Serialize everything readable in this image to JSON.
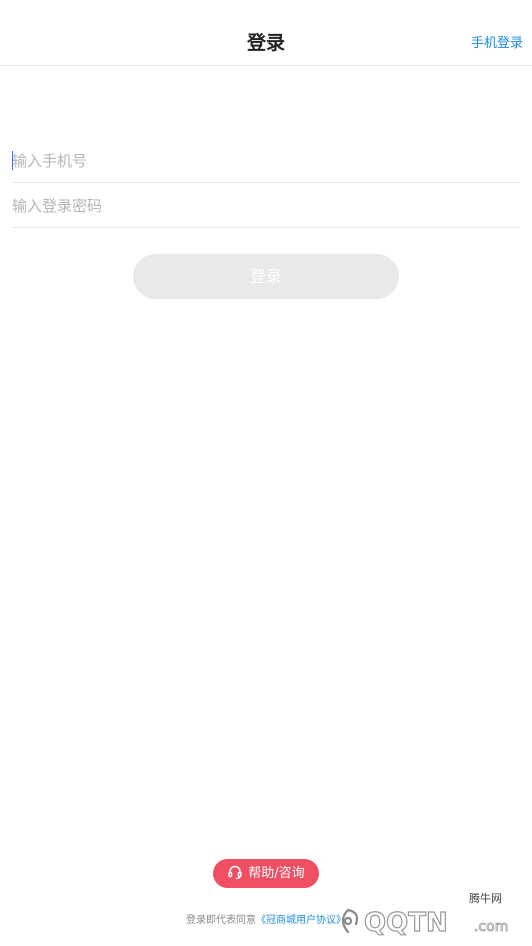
{
  "header": {
    "title": "登录",
    "phone_login_link": "手机登录"
  },
  "form": {
    "phone_placeholder": "输入手机号",
    "password_placeholder": "输入登录密码",
    "login_button": "登录"
  },
  "footer": {
    "help_button": "帮助/咨询",
    "agreement_prefix": "登录即代表同意",
    "agreement_link": "《冠商城用户协议》"
  },
  "watermark": {
    "site_name": "腾牛网",
    "brand_text": "QQTN",
    "domain_suffix": ".com"
  },
  "colors": {
    "accent_blue": "#1f8ce8",
    "help_red": "#f04e63",
    "button_disabled": "#e9e9e9"
  },
  "icons": {
    "help": "headset-icon",
    "watermark": "qqtn-logo"
  }
}
